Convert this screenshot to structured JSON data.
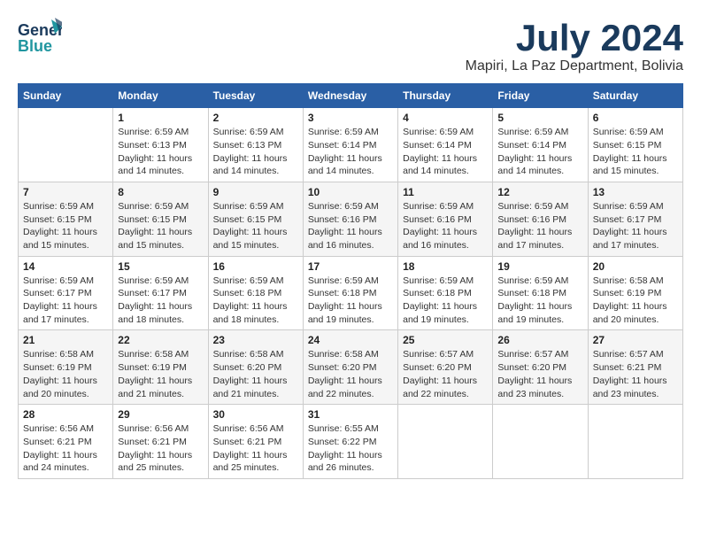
{
  "logo": {
    "line1": "General",
    "line2": "Blue"
  },
  "header": {
    "month": "July 2024",
    "location": "Mapiri, La Paz Department, Bolivia"
  },
  "weekdays": [
    "Sunday",
    "Monday",
    "Tuesday",
    "Wednesday",
    "Thursday",
    "Friday",
    "Saturday"
  ],
  "weeks": [
    [
      {
        "day": "",
        "info": ""
      },
      {
        "day": "1",
        "info": "Sunrise: 6:59 AM\nSunset: 6:13 PM\nDaylight: 11 hours\nand 14 minutes."
      },
      {
        "day": "2",
        "info": "Sunrise: 6:59 AM\nSunset: 6:13 PM\nDaylight: 11 hours\nand 14 minutes."
      },
      {
        "day": "3",
        "info": "Sunrise: 6:59 AM\nSunset: 6:14 PM\nDaylight: 11 hours\nand 14 minutes."
      },
      {
        "day": "4",
        "info": "Sunrise: 6:59 AM\nSunset: 6:14 PM\nDaylight: 11 hours\nand 14 minutes."
      },
      {
        "day": "5",
        "info": "Sunrise: 6:59 AM\nSunset: 6:14 PM\nDaylight: 11 hours\nand 14 minutes."
      },
      {
        "day": "6",
        "info": "Sunrise: 6:59 AM\nSunset: 6:15 PM\nDaylight: 11 hours\nand 15 minutes."
      }
    ],
    [
      {
        "day": "7",
        "info": "Sunrise: 6:59 AM\nSunset: 6:15 PM\nDaylight: 11 hours\nand 15 minutes."
      },
      {
        "day": "8",
        "info": "Sunrise: 6:59 AM\nSunset: 6:15 PM\nDaylight: 11 hours\nand 15 minutes."
      },
      {
        "day": "9",
        "info": "Sunrise: 6:59 AM\nSunset: 6:15 PM\nDaylight: 11 hours\nand 15 minutes."
      },
      {
        "day": "10",
        "info": "Sunrise: 6:59 AM\nSunset: 6:16 PM\nDaylight: 11 hours\nand 16 minutes."
      },
      {
        "day": "11",
        "info": "Sunrise: 6:59 AM\nSunset: 6:16 PM\nDaylight: 11 hours\nand 16 minutes."
      },
      {
        "day": "12",
        "info": "Sunrise: 6:59 AM\nSunset: 6:16 PM\nDaylight: 11 hours\nand 17 minutes."
      },
      {
        "day": "13",
        "info": "Sunrise: 6:59 AM\nSunset: 6:17 PM\nDaylight: 11 hours\nand 17 minutes."
      }
    ],
    [
      {
        "day": "14",
        "info": "Sunrise: 6:59 AM\nSunset: 6:17 PM\nDaylight: 11 hours\nand 17 minutes."
      },
      {
        "day": "15",
        "info": "Sunrise: 6:59 AM\nSunset: 6:17 PM\nDaylight: 11 hours\nand 18 minutes."
      },
      {
        "day": "16",
        "info": "Sunrise: 6:59 AM\nSunset: 6:18 PM\nDaylight: 11 hours\nand 18 minutes."
      },
      {
        "day": "17",
        "info": "Sunrise: 6:59 AM\nSunset: 6:18 PM\nDaylight: 11 hours\nand 19 minutes."
      },
      {
        "day": "18",
        "info": "Sunrise: 6:59 AM\nSunset: 6:18 PM\nDaylight: 11 hours\nand 19 minutes."
      },
      {
        "day": "19",
        "info": "Sunrise: 6:59 AM\nSunset: 6:18 PM\nDaylight: 11 hours\nand 19 minutes."
      },
      {
        "day": "20",
        "info": "Sunrise: 6:58 AM\nSunset: 6:19 PM\nDaylight: 11 hours\nand 20 minutes."
      }
    ],
    [
      {
        "day": "21",
        "info": "Sunrise: 6:58 AM\nSunset: 6:19 PM\nDaylight: 11 hours\nand 20 minutes."
      },
      {
        "day": "22",
        "info": "Sunrise: 6:58 AM\nSunset: 6:19 PM\nDaylight: 11 hours\nand 21 minutes."
      },
      {
        "day": "23",
        "info": "Sunrise: 6:58 AM\nSunset: 6:20 PM\nDaylight: 11 hours\nand 21 minutes."
      },
      {
        "day": "24",
        "info": "Sunrise: 6:58 AM\nSunset: 6:20 PM\nDaylight: 11 hours\nand 22 minutes."
      },
      {
        "day": "25",
        "info": "Sunrise: 6:57 AM\nSunset: 6:20 PM\nDaylight: 11 hours\nand 22 minutes."
      },
      {
        "day": "26",
        "info": "Sunrise: 6:57 AM\nSunset: 6:20 PM\nDaylight: 11 hours\nand 23 minutes."
      },
      {
        "day": "27",
        "info": "Sunrise: 6:57 AM\nSunset: 6:21 PM\nDaylight: 11 hours\nand 23 minutes."
      }
    ],
    [
      {
        "day": "28",
        "info": "Sunrise: 6:56 AM\nSunset: 6:21 PM\nDaylight: 11 hours\nand 24 minutes."
      },
      {
        "day": "29",
        "info": "Sunrise: 6:56 AM\nSunset: 6:21 PM\nDaylight: 11 hours\nand 25 minutes."
      },
      {
        "day": "30",
        "info": "Sunrise: 6:56 AM\nSunset: 6:21 PM\nDaylight: 11 hours\nand 25 minutes."
      },
      {
        "day": "31",
        "info": "Sunrise: 6:55 AM\nSunset: 6:22 PM\nDaylight: 11 hours\nand 26 minutes."
      },
      {
        "day": "",
        "info": ""
      },
      {
        "day": "",
        "info": ""
      },
      {
        "day": "",
        "info": ""
      }
    ]
  ]
}
